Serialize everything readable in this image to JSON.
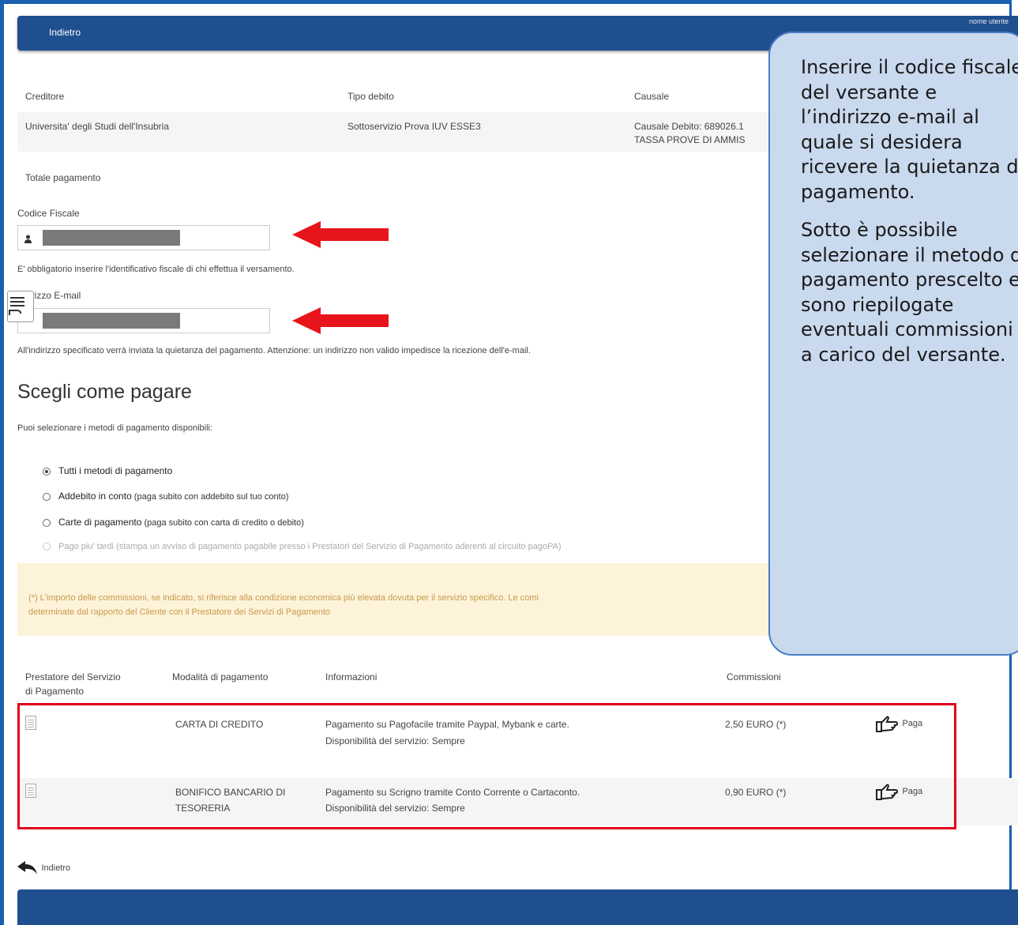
{
  "header": {
    "back_label": "Indietro",
    "corner_text": "nome utente"
  },
  "summary": {
    "headers": {
      "creditore": "Creditore",
      "tipo_debito": "Tipo debito",
      "causale": "Causale"
    },
    "row": {
      "creditore": "Universita' degli Studi dell'Insubria",
      "tipo_debito": "Sottoservizio Prova IUV ESSE3",
      "causale_1": "Causale Debito: 689026.1",
      "causale_2": "TASSA PROVE DI AMMIS"
    },
    "totale_label": "Totale pagamento"
  },
  "form": {
    "cf_label": "Codice Fiscale",
    "cf_help": "E' obbligatorio inserire l'identificativo fiscale di chi effettua il versamento.",
    "email_label": "Indirizzo E-mail",
    "email_label_visible": "irizzo E-mail",
    "email_help": "All'indirizzo specificato verrà inviata la quietanza del pagamento. Attenzione: un indirizzo non valido impedisce la ricezione dell'e-mail."
  },
  "payment": {
    "title": "Scegli come pagare",
    "subtitle": "Puoi selezionare i metodi di pagamento disponibili:",
    "options": [
      {
        "bold": "Tutti i metodi di pagamento",
        "rest": "",
        "selected": true,
        "disabled": false
      },
      {
        "bold": "Addebito in conto",
        "rest": " (paga subito con addebito sul tuo conto)",
        "selected": false,
        "disabled": false
      },
      {
        "bold": "Carte di pagamento",
        "rest": " (paga subito con carta di credito o debito)",
        "selected": false,
        "disabled": false
      },
      {
        "bold": "Pago piu' tardi",
        "rest": " (stampa un avviso di pagamento pagabile presso i Prestatori del Servizio di Pagamento aderenti al circuito pagoPA)",
        "selected": false,
        "disabled": true
      }
    ],
    "note_line1": "(*) L'importo delle commissioni, se indicato, si riferisce alla condizione economica più elevata dovuta per il servizio specifico. Le comi",
    "note_line2": "determinate dal rapporto del Cliente con il Prestatore dei Servizi di Pagamento"
  },
  "table": {
    "headers": {
      "psp_1": "Prestatore del Servizio",
      "psp_2": "di Pagamento",
      "modalita": "Modalità di pagamento",
      "info": "Informazioni",
      "commissioni": "Commissioni"
    },
    "rows": [
      {
        "modalita_1": "CARTA DI CREDITO",
        "modalita_2": "",
        "info_1": "Pagamento su Pagofacile tramite Paypal, Mybank e carte.",
        "info_2": "Disponibilità del servizio: Sempre",
        "commissione": "2,50 EURO (*)",
        "pay_label": "Paga"
      },
      {
        "modalita_1": "BONIFICO BANCARIO DI",
        "modalita_2": "TESORERIA",
        "info_1": "Pagamento su Scrigno tramite Conto Corrente o Cartaconto.",
        "info_2": "Disponibilità del servizio: Sempre",
        "commissione": "0,90 EURO (*)",
        "pay_label": "Paga"
      }
    ]
  },
  "footer": {
    "back_label": "Indietro"
  },
  "callout": {
    "paragraph1": "Inserire il codice fiscale del versante e l’indirizzo e-mail al quale si desidera ricevere la quietanza di pagamento.",
    "paragraph2": "Sotto è possibile selezionare il metodo di pagamento prescelto e sono riepilogate eventuali commissioni a carico del versante."
  },
  "colors": {
    "brand_blue": "#1f4f8f",
    "highlight_red": "#e0001b",
    "arrow_red": "#e8141b",
    "callout_fill": "#c9d9ee",
    "note_fill": "#fdf3d9"
  }
}
